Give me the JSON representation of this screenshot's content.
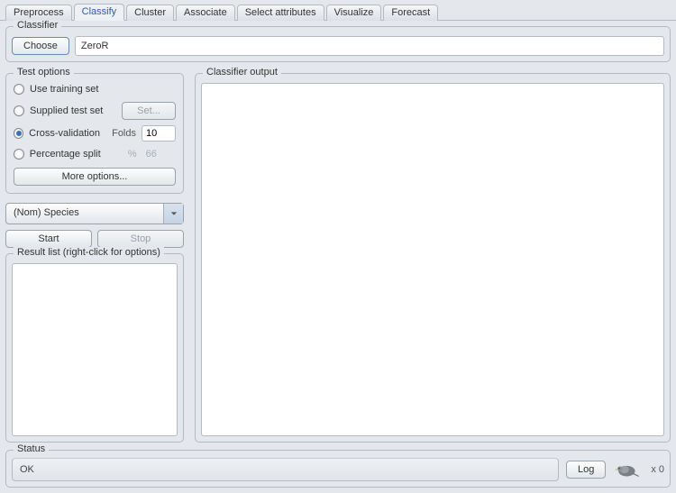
{
  "tabs": [
    "Preprocess",
    "Classify",
    "Cluster",
    "Associate",
    "Select attributes",
    "Visualize",
    "Forecast"
  ],
  "active_tab_index": 1,
  "classifier": {
    "legend": "Classifier",
    "choose_label": "Choose",
    "name": "ZeroR"
  },
  "test_options": {
    "legend": "Test options",
    "items": [
      {
        "label": "Use training set",
        "checked": false
      },
      {
        "label": "Supplied test set",
        "checked": false,
        "set_button": "Set..."
      },
      {
        "label": "Cross-validation",
        "checked": true,
        "param_label": "Folds",
        "param_value": "10"
      },
      {
        "label": "Percentage split",
        "checked": false,
        "param_label": "%",
        "param_value": "66"
      }
    ],
    "more_label": "More options..."
  },
  "class_combo": "(Nom) Species",
  "start_label": "Start",
  "stop_label": "Stop",
  "result_list_legend": "Result list (right-click for options)",
  "output_legend": "Classifier output",
  "status": {
    "legend": "Status",
    "text": "OK",
    "log_label": "Log",
    "count": "x 0"
  }
}
